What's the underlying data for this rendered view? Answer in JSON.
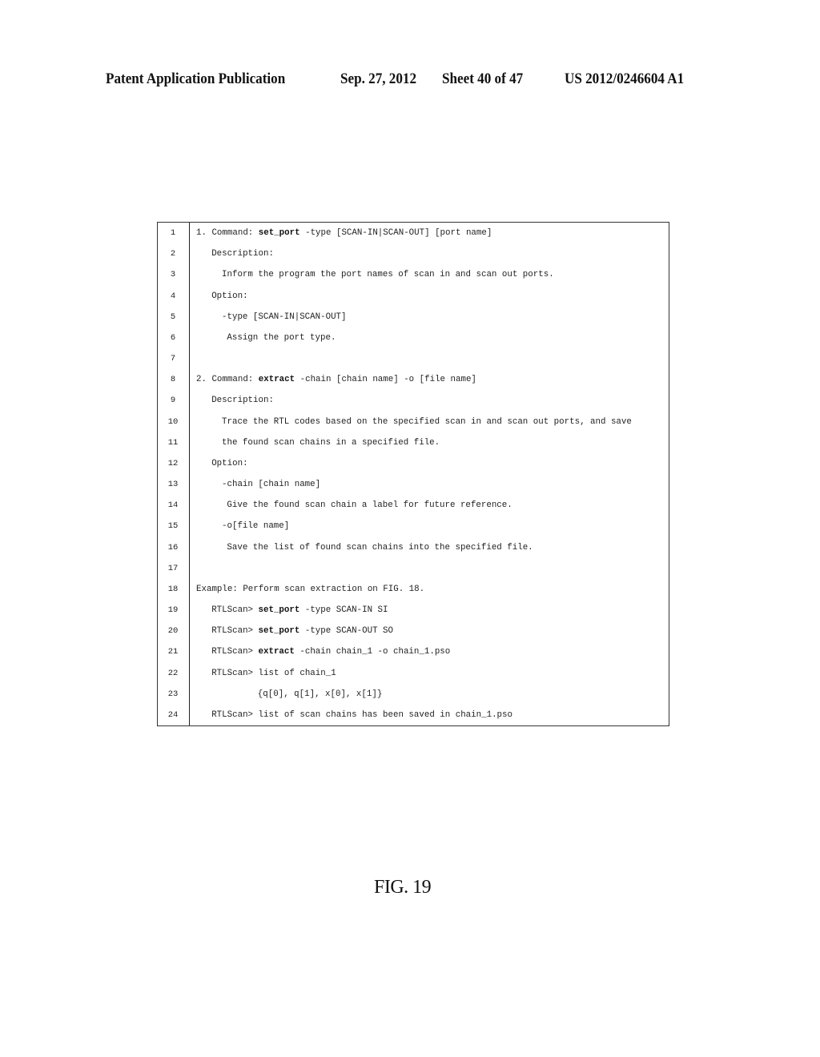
{
  "header": {
    "publication": "Patent Application Publication",
    "date": "Sep. 27, 2012",
    "sheet": "Sheet 40 of 47",
    "number": "US 2012/0246604 A1"
  },
  "listing": {
    "lines": [
      {
        "n": "1",
        "indent": 0,
        "parts": [
          {
            "t": "1. Command: "
          },
          {
            "t": "set_port",
            "b": true
          },
          {
            "t": " -type [SCAN-IN|SCAN-OUT] [port name]"
          }
        ]
      },
      {
        "n": "2",
        "indent": 3,
        "parts": [
          {
            "t": "Description:"
          }
        ]
      },
      {
        "n": "3",
        "indent": 5,
        "parts": [
          {
            "t": "Inform the program the port names of scan in and scan out ports."
          }
        ]
      },
      {
        "n": "4",
        "indent": 3,
        "parts": [
          {
            "t": "Option:"
          }
        ]
      },
      {
        "n": "5",
        "indent": 5,
        "parts": [
          {
            "t": "-type [SCAN-IN|SCAN-OUT]"
          }
        ]
      },
      {
        "n": "6",
        "indent": 6,
        "parts": [
          {
            "t": "Assign the port type."
          }
        ]
      },
      {
        "n": "7",
        "indent": 0,
        "parts": []
      },
      {
        "n": "8",
        "indent": 0,
        "parts": [
          {
            "t": "2. Command: "
          },
          {
            "t": "extract",
            "b": true
          },
          {
            "t": " -chain [chain name] -o [file name]"
          }
        ]
      },
      {
        "n": "9",
        "indent": 3,
        "parts": [
          {
            "t": "Description:"
          }
        ]
      },
      {
        "n": "10",
        "indent": 5,
        "parts": [
          {
            "t": "Trace the RTL codes based on the specified scan in and scan out ports, and save"
          }
        ]
      },
      {
        "n": "11",
        "indent": 5,
        "parts": [
          {
            "t": "the found scan chains in a specified file."
          }
        ]
      },
      {
        "n": "12",
        "indent": 3,
        "parts": [
          {
            "t": "Option:"
          }
        ]
      },
      {
        "n": "13",
        "indent": 5,
        "parts": [
          {
            "t": "-chain [chain name]"
          }
        ]
      },
      {
        "n": "14",
        "indent": 6,
        "parts": [
          {
            "t": "Give the found scan chain a label for future reference."
          }
        ]
      },
      {
        "n": "15",
        "indent": 5,
        "parts": [
          {
            "t": "-o[file name]"
          }
        ]
      },
      {
        "n": "16",
        "indent": 6,
        "parts": [
          {
            "t": "Save the list of found scan chains into the specified file."
          }
        ]
      },
      {
        "n": "17",
        "indent": 0,
        "parts": []
      },
      {
        "n": "18",
        "indent": 0,
        "parts": [
          {
            "t": "Example: Perform scan extraction on FIG. 18."
          }
        ]
      },
      {
        "n": "19",
        "indent": 3,
        "parts": [
          {
            "t": "RTLScan> "
          },
          {
            "t": "set_port",
            "b": true
          },
          {
            "t": " -type SCAN-IN SI"
          }
        ]
      },
      {
        "n": "20",
        "indent": 3,
        "parts": [
          {
            "t": "RTLScan> "
          },
          {
            "t": "set_port",
            "b": true
          },
          {
            "t": " -type SCAN-OUT SO"
          }
        ]
      },
      {
        "n": "21",
        "indent": 3,
        "parts": [
          {
            "t": "RTLScan> "
          },
          {
            "t": "extract",
            "b": true
          },
          {
            "t": " -chain chain_1 -o chain_1.pso"
          }
        ]
      },
      {
        "n": "22",
        "indent": 3,
        "parts": [
          {
            "t": "RTLScan> list of chain_1"
          }
        ]
      },
      {
        "n": "23",
        "indent": 12,
        "parts": [
          {
            "t": "{q[0], q[1], x[0], x[1]}"
          }
        ]
      },
      {
        "n": "24",
        "indent": 3,
        "parts": [
          {
            "t": "RTLScan> list of scan chains has been saved in chain_1.pso"
          }
        ]
      }
    ]
  },
  "figure_label": "FIG. 19"
}
